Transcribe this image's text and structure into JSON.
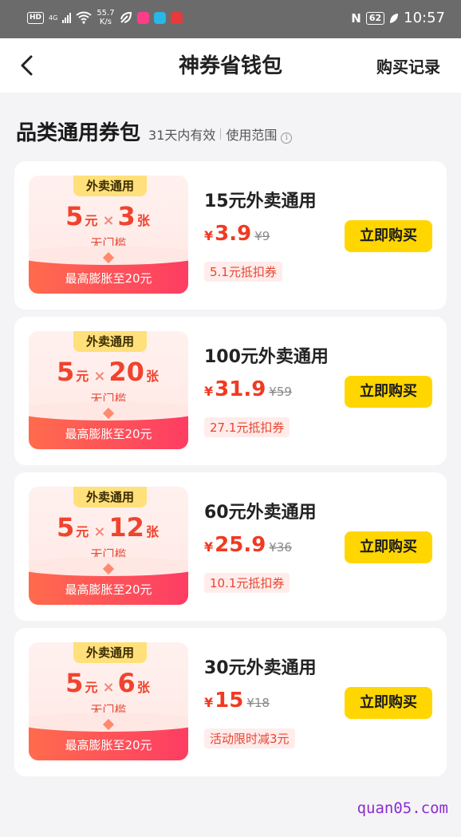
{
  "status_bar": {
    "hd": "HD",
    "network": "4G",
    "speed_value": "55.7",
    "speed_unit": "K/s",
    "battery": "62",
    "time": "10:57",
    "nfc": "N"
  },
  "nav": {
    "back_icon": "chevron-left-icon",
    "title": "神券省钱包",
    "action": "购买记录"
  },
  "section": {
    "title": "品类通用券包",
    "validity": "31天内有效",
    "scope": "使用范围",
    "info_icon": "info-icon"
  },
  "products": [
    {
      "tag": "外卖通用",
      "coupon_value": "5",
      "coupon_unit": "元",
      "times": "×",
      "count": "3",
      "count_unit": "张",
      "threshold": "无门槛",
      "bonus": "最高膨胀至20元",
      "title": "15元外卖通用",
      "currency": "¥",
      "price": "3.9",
      "original_price": "¥9",
      "badge": "5.1元抵扣券",
      "button": "立即购买"
    },
    {
      "tag": "外卖通用",
      "coupon_value": "5",
      "coupon_unit": "元",
      "times": "×",
      "count": "20",
      "count_unit": "张",
      "threshold": "无门槛",
      "bonus": "最高膨胀至20元",
      "title": "100元外卖通用",
      "currency": "¥",
      "price": "31.9",
      "original_price": "¥59",
      "badge": "27.1元抵扣券",
      "button": "立即购买"
    },
    {
      "tag": "外卖通用",
      "coupon_value": "5",
      "coupon_unit": "元",
      "times": "×",
      "count": "12",
      "count_unit": "张",
      "threshold": "无门槛",
      "bonus": "最高膨胀至20元",
      "title": "60元外卖通用",
      "currency": "¥",
      "price": "25.9",
      "original_price": "¥36",
      "badge": "10.1元抵扣券",
      "button": "立即购买"
    },
    {
      "tag": "外卖通用",
      "coupon_value": "5",
      "coupon_unit": "元",
      "times": "×",
      "count": "6",
      "count_unit": "张",
      "threshold": "无门槛",
      "bonus": "最高膨胀至20元",
      "title": "30元外卖通用",
      "currency": "¥",
      "price": "15",
      "original_price": "¥18",
      "badge": "活动限时减3元",
      "button": "立即购买"
    }
  ],
  "watermark": "quan05.com",
  "colors": {
    "accent_red": "#f03a22",
    "button_yellow": "#ffd600",
    "tag_yellow": "#ffe07a",
    "band_gradient_start": "#ff6b4d",
    "band_gradient_end": "#fd3d63",
    "watermark": "#8d2bd1"
  }
}
